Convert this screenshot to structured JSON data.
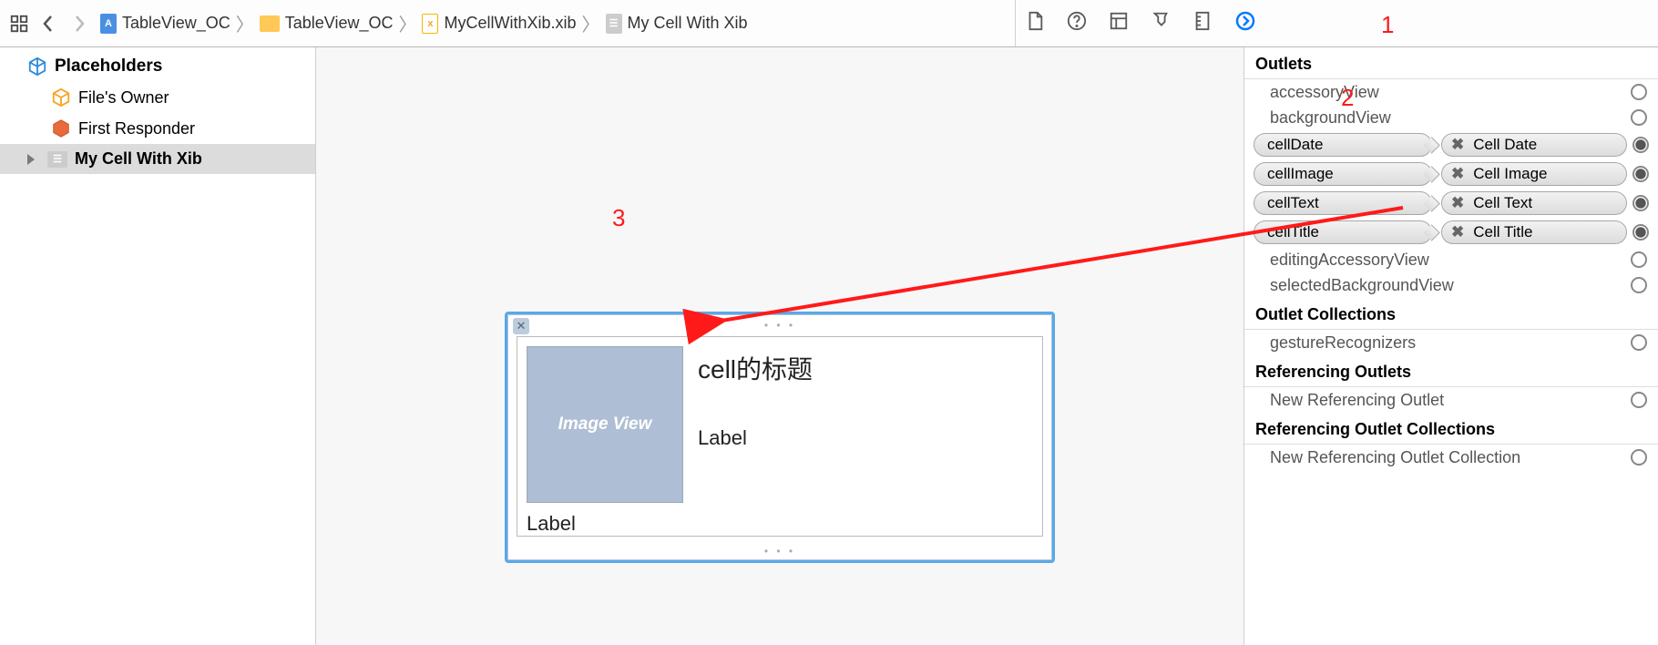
{
  "breadcrumb": {
    "project": "TableView_OC",
    "folder": "TableView_OC",
    "file": "MyCellWithXib.xib",
    "object": "My Cell With Xib"
  },
  "outline": {
    "placeholders": "Placeholders",
    "filesOwner": "File's Owner",
    "firstResponder": "First Responder",
    "rootObject": "My Cell With Xib"
  },
  "canvas": {
    "imageView": "Image View",
    "title": "cell的标题",
    "midLabel": "Label",
    "bottomLabel": "Label"
  },
  "inspector": {
    "sections": {
      "outlets": "Outlets",
      "outletCollections": "Outlet Collections",
      "referencingOutlets": "Referencing Outlets",
      "referencingOutletCollections": "Referencing Outlet Collections"
    },
    "outlets": {
      "accessoryView": "accessoryView",
      "backgroundView": "backgroundView",
      "cellDate": {
        "name": "cellDate",
        "target": "Cell Date"
      },
      "cellImage": {
        "name": "cellImage",
        "target": "Cell Image"
      },
      "cellText": {
        "name": "cellText",
        "target": "Cell Text"
      },
      "cellTitle": {
        "name": "cellTitle",
        "target": "Cell Title"
      },
      "editingAccessoryView": "editingAccessoryView",
      "selectedBackgroundView": "selectedBackgroundView"
    },
    "outletCollections": {
      "gestureRecognizers": "gestureRecognizers"
    },
    "referencingOutlets": {
      "new": "New Referencing Outlet"
    },
    "referencingOutletCollections": {
      "new": "New Referencing Outlet Collection"
    }
  },
  "annotations": {
    "one": "1",
    "two": "2",
    "three": "3"
  }
}
